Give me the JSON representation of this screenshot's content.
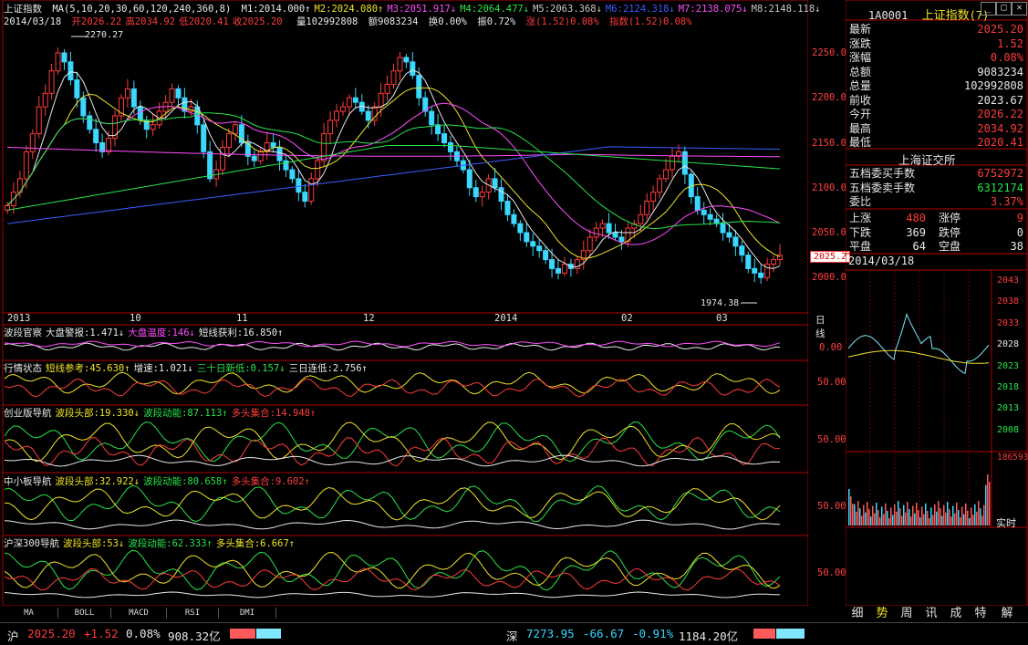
{
  "window": {
    "title": "上证指数",
    "min_button": "_",
    "max_button": "□",
    "close_button": "✕"
  },
  "header": {
    "ma_label": "MA(5,10,20,30,60,120,240,360,8)",
    "ma_values": [
      {
        "name": "M1",
        "value": "2014.000",
        "arrow": "↑",
        "color": "#e8e8e8"
      },
      {
        "name": "M2",
        "value": "2024.080",
        "arrow": "↑",
        "color": "#f0e32a"
      },
      {
        "name": "M3",
        "value": "2051.917",
        "arrow": "↓",
        "color": "#ff4dff"
      },
      {
        "name": "M4",
        "value": "2064.477",
        "arrow": "↓",
        "color": "#29e34a"
      },
      {
        "name": "M5",
        "value": "2063.368",
        "arrow": "↓",
        "color": "#c8c8c8"
      },
      {
        "name": "M6",
        "value": "2124.318",
        "arrow": "↓",
        "color": "#3a5cff"
      },
      {
        "name": "M7",
        "value": "2138.075",
        "arrow": "↓",
        "color": "#ff4dff"
      },
      {
        "name": "M8",
        "value": "2148.118",
        "arrow": "↓",
        "color": "#c8c8c8"
      }
    ],
    "date": "2014/03/18",
    "ohlc": [
      {
        "label": "开",
        "value": "2026.22"
      },
      {
        "label": "高",
        "value": "2034.92"
      },
      {
        "label": "低",
        "value": "2020.41"
      },
      {
        "label": "收",
        "value": "2025.20"
      }
    ],
    "volume": "量102992808",
    "amount": "额9083234",
    "turnover": "换0.00%",
    "amplitude": "振0.72%",
    "change": "涨(1.52)0.08%",
    "index": "指数(1.52)0.08%"
  },
  "price_axis": {
    "ticks": [
      "2250.0",
      "2200.0",
      "2150.0",
      "2100.0",
      "2050.0",
      "2000.0"
    ],
    "current": "2025.2"
  },
  "annotations": {
    "high": "2270.27",
    "low": "1974.38"
  },
  "x_axis": {
    "labels": [
      "2013",
      "10",
      "11",
      "12",
      "2014",
      "02",
      "03"
    ],
    "period": "日线"
  },
  "panels": [
    {
      "title": "波段官察",
      "items": [
        {
          "label": "大盘警报:1.471",
          "arrow": "↓",
          "color": "#e8e8e8"
        },
        {
          "label": "大盘温度:146",
          "arrow": "↓",
          "color": "#ff4dff"
        },
        {
          "label": "短线获利:16.850",
          "arrow": "↑",
          "color": "#e8e8e8"
        }
      ],
      "axis": "0.00"
    },
    {
      "title": "行情状态",
      "items": [
        {
          "label": "短线参考:45.630",
          "arrow": "↑",
          "color": "#f0e32a"
        },
        {
          "label": "增速:1.021",
          "arrow": "↓",
          "color": "#e8e8e8"
        },
        {
          "label": "三十日新低:0.157",
          "arrow": "↓",
          "color": "#29e34a"
        },
        {
          "label": "三日连低:2.756",
          "arrow": "↑",
          "color": "#e8e8e8"
        }
      ],
      "axis": "50.00"
    },
    {
      "title": "创业版导航",
      "items": [
        {
          "label": "波段头部:19.330",
          "arrow": "↓",
          "color": "#f0e32a"
        },
        {
          "label": "波段动能:87.113",
          "arrow": "↑",
          "color": "#29e34a"
        },
        {
          "label": "多头集合:14.948",
          "arrow": "↑",
          "color": "#ff3b3b"
        }
      ],
      "axis": "50.00"
    },
    {
      "title": "中小板导航",
      "items": [
        {
          "label": "波段头部:32.922",
          "arrow": "↓",
          "color": "#f0e32a"
        },
        {
          "label": "波段动能:80.658",
          "arrow": "↑",
          "color": "#29e34a"
        },
        {
          "label": "多头集合:9.602",
          "arrow": "↑",
          "color": "#ff3b3b"
        }
      ],
      "axis": "50.00"
    },
    {
      "title": "沪深300导航",
      "items": [
        {
          "label": "波段头部:53",
          "arrow": "↓",
          "color": "#f0e32a"
        },
        {
          "label": "波段动能:62.333",
          "arrow": "↑",
          "color": "#29e34a"
        },
        {
          "label": "多头集合:6.667",
          "arrow": "↑",
          "color": "#f0e32a"
        }
      ],
      "axis": "50.00"
    }
  ],
  "bottom_tabs": [
    "MA",
    "BOLL",
    "MACD",
    "RSI",
    "DMI"
  ],
  "right_panel": {
    "code": "1A0001",
    "name": "上证指数",
    "suffix": "(7)",
    "quotes": [
      {
        "label": "最新",
        "value": "2025.20",
        "color": "#ff3b3b"
      },
      {
        "label": "涨跌",
        "value": "1.52",
        "color": "#ff3b3b"
      },
      {
        "label": "涨幅",
        "value": "0.08%",
        "color": "#ff3b3b"
      },
      {
        "label": "总额",
        "value": "9083234",
        "color": "#e8e8e8"
      },
      {
        "label": "总量",
        "value": "102992808",
        "color": "#e8e8e8"
      },
      {
        "label": "前收",
        "value": "2023.67",
        "color": "#e8e8e8"
      },
      {
        "label": "今开",
        "value": "2026.22",
        "color": "#ff3b3b"
      },
      {
        "label": "最高",
        "value": "2034.92",
        "color": "#ff3b3b"
      },
      {
        "label": "最低",
        "value": "2020.41",
        "color": "#ff3b3b"
      }
    ],
    "exchange": "上海证交所",
    "order_book": [
      {
        "label": "五档委买手数",
        "value": "6752972",
        "color": "#ff3b3b"
      },
      {
        "label": "五档委卖手数",
        "value": "6312174",
        "color": "#29e34a"
      },
      {
        "label": "委比",
        "value": "3.37%",
        "color": "#ff3b3b"
      }
    ],
    "breadth": [
      {
        "l1": "上涨",
        "v1": "480",
        "c1": "#ff3b3b",
        "l2": "涨停",
        "v2": "9",
        "c2": "#ff3b3b"
      },
      {
        "l1": "下跌",
        "v1": "369",
        "c1": "#e8e8e8",
        "l2": "跌停",
        "v2": "0",
        "c2": "#e8e8e8"
      },
      {
        "l1": "平盘",
        "v1": "64",
        "c1": "#e8e8e8",
        "l2": "空盘",
        "v2": "38",
        "c2": "#e8e8e8"
      }
    ],
    "date": "2014/03/18",
    "mini_ticks": [
      "2043",
      "2038",
      "2033",
      "2028",
      "2023",
      "2018",
      "2013",
      "2008"
    ],
    "vol_tick": "186593",
    "realtime": "实时",
    "tabs": [
      "细",
      "势",
      "周",
      "讯",
      "成",
      "特",
      "解"
    ]
  },
  "status_bar": {
    "sh_label": "沪",
    "sh_price": "2025.20",
    "sh_change": "+1.52",
    "sh_pct": "0.08%",
    "sh_amount": "908.32亿",
    "sz_label": "深",
    "sz_price": "7273.95",
    "sz_change": "-66.67",
    "sz_pct": "-0.91%",
    "sz_amount": "1184.20亿"
  }
}
